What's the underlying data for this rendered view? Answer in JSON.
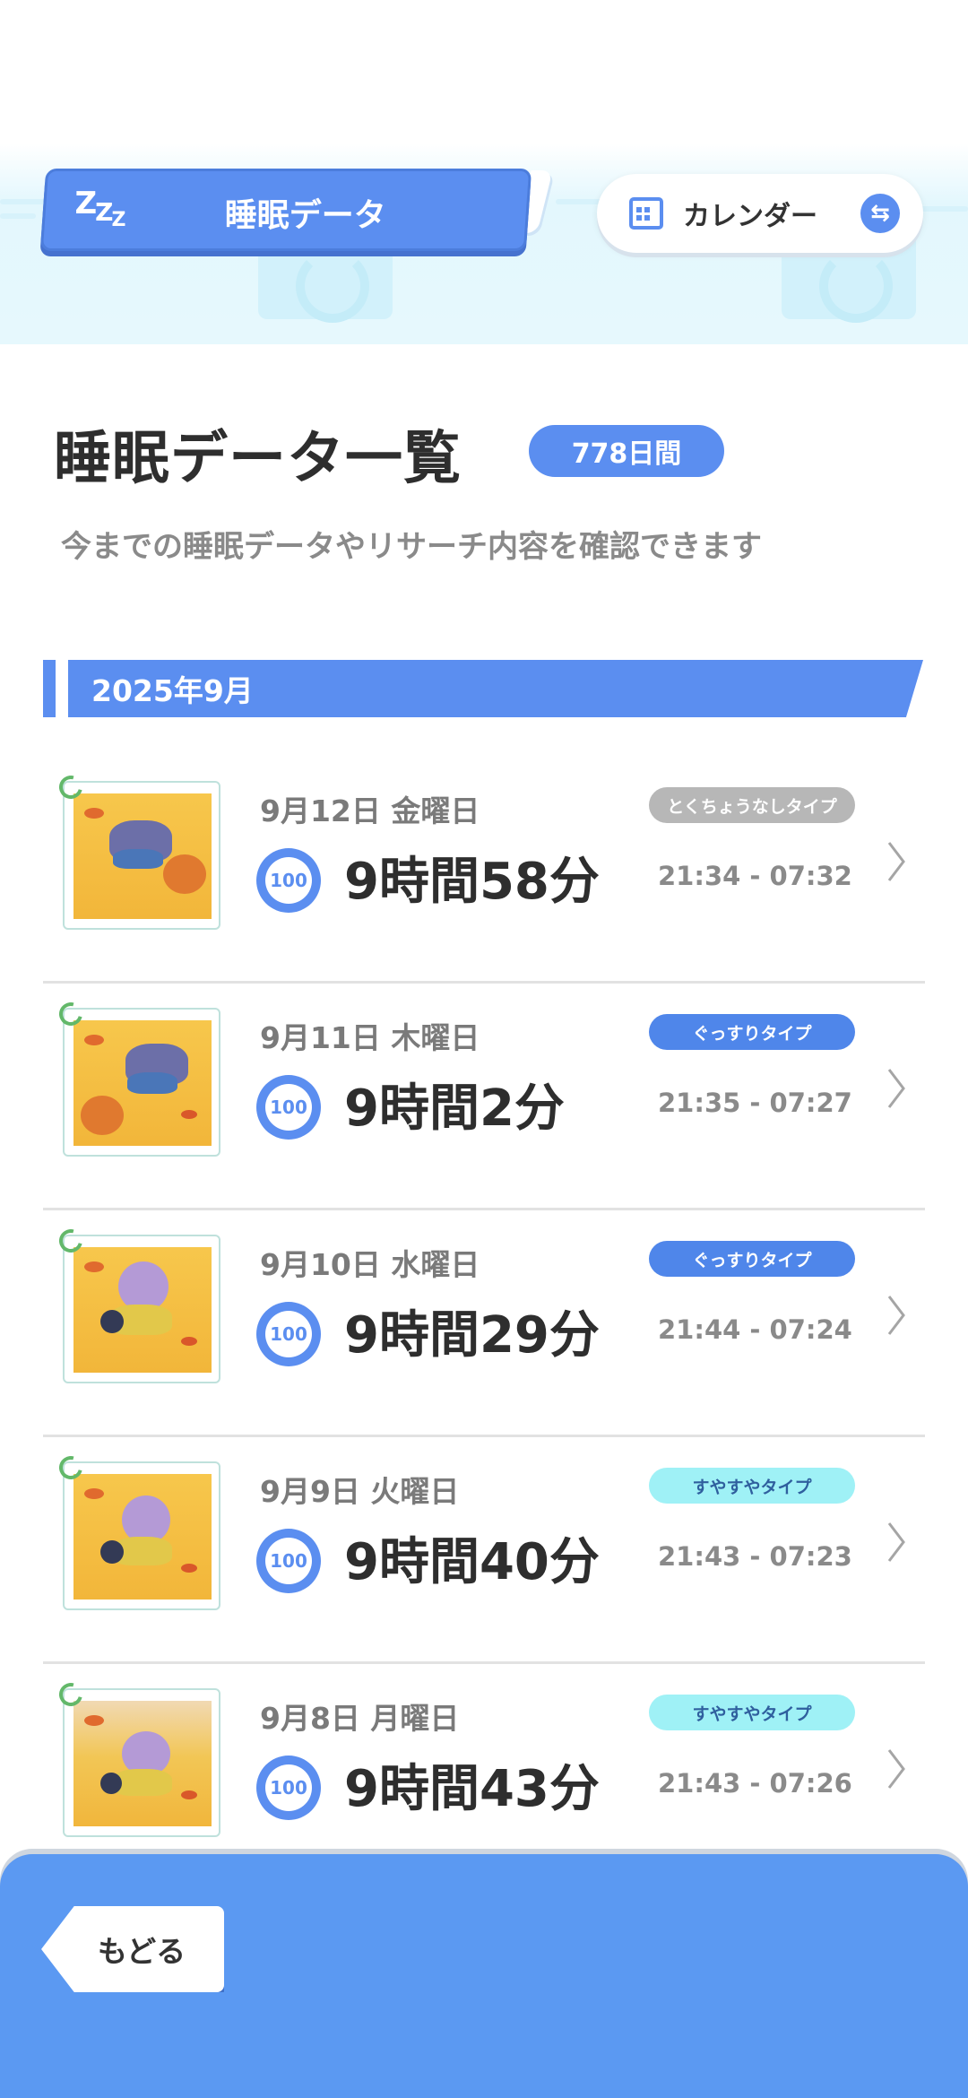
{
  "header": {
    "title": "睡眠データ",
    "zzz": [
      "Z",
      "Z",
      "Z"
    ],
    "calendar_label": "カレンダー",
    "swap_glyph": "⇆"
  },
  "summary": {
    "title": "睡眠データ一覧",
    "days_badge": "778日間",
    "subtitle": "今までの睡眠データやリサーチ内容を確認できます"
  },
  "month": "2025年9月",
  "score_icon_label": "100",
  "entries": [
    {
      "date": "9月12日 金曜日",
      "score": "100",
      "duration": "9時間58分",
      "type": "とくちょうなしタイプ",
      "time_range": "21:34 - 07:32",
      "badge_bg": "#b7b7b7",
      "badge_fg": "#ffffff"
    },
    {
      "date": "9月11日 木曜日",
      "score": "100",
      "duration": "9時間2分",
      "type": "ぐっすりタイプ",
      "time_range": "21:35 - 07:27",
      "badge_bg": "#4f86ea",
      "badge_fg": "#ffffff"
    },
    {
      "date": "9月10日 水曜日",
      "score": "100",
      "duration": "9時間29分",
      "type": "ぐっすりタイプ",
      "time_range": "21:44 - 07:24",
      "badge_bg": "#4f86ea",
      "badge_fg": "#ffffff"
    },
    {
      "date": "9月9日 火曜日",
      "score": "100",
      "duration": "9時間40分",
      "type": "すやすやタイプ",
      "time_range": "21:43 - 07:23",
      "badge_bg": "#9ff1f6",
      "badge_fg": "#2f5f9e"
    },
    {
      "date": "9月8日 月曜日",
      "score": "100",
      "duration": "9時間43分",
      "type": "すやすやタイプ",
      "time_range": "21:43 - 07:26",
      "badge_bg": "#9ff1f6",
      "badge_fg": "#2f5f9e"
    }
  ],
  "footer": {
    "back_label": "もどる"
  },
  "colors": {
    "accent": "#5b8ef0",
    "footer": "#5b99f2"
  }
}
